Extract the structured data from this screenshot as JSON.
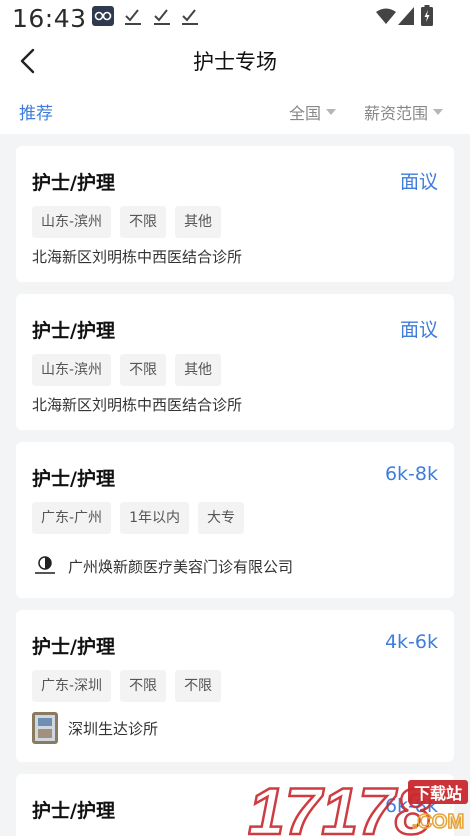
{
  "status_bar": {
    "time": "16:43",
    "icons": [
      "app-notification-icon",
      "check-icon",
      "check-icon",
      "check-icon",
      "wifi-icon",
      "signal-icon",
      "battery-icon"
    ]
  },
  "header": {
    "title": "护士专场",
    "back_icon": "chevron-left-icon"
  },
  "filters": {
    "recommend": "推荐",
    "region": "全国",
    "salary_range": "薪资范围"
  },
  "jobs": [
    {
      "title": "护士/护理",
      "salary": "面议",
      "tags": [
        "山东-滨州",
        "不限",
        "其他"
      ],
      "company": "北海新区刘明栋中西医结合诊所",
      "logo": "none"
    },
    {
      "title": "护士/护理",
      "salary": "面议",
      "tags": [
        "山东-滨州",
        "不限",
        "其他"
      ],
      "company": "北海新区刘明栋中西医结合诊所",
      "logo": "none"
    },
    {
      "title": "护士/护理",
      "salary": "6k-8k",
      "tags": [
        "广东-广州",
        "1年以内",
        "大专"
      ],
      "company": "广州焕新颜医疗美容门诊有限公司",
      "logo": "clinic-logo-circle"
    },
    {
      "title": "护士/护理",
      "salary": "4k-6k",
      "tags": [
        "广东-深圳",
        "不限",
        "不限"
      ],
      "company": "深圳生达诊所",
      "logo": "clinic-photo-logo"
    },
    {
      "title": "护士/护理",
      "salary": "6k-8k"
    }
  ],
  "watermark": {
    "number": "17178",
    "site": "下载站",
    "domain": ".COM"
  },
  "colors": {
    "accent": "#3f7ddc",
    "page_bg": "#f3f4f6",
    "tag_bg": "#f3f3f3",
    "watermark_red": "#c9282d",
    "watermark_gold": "#e6a63c"
  }
}
